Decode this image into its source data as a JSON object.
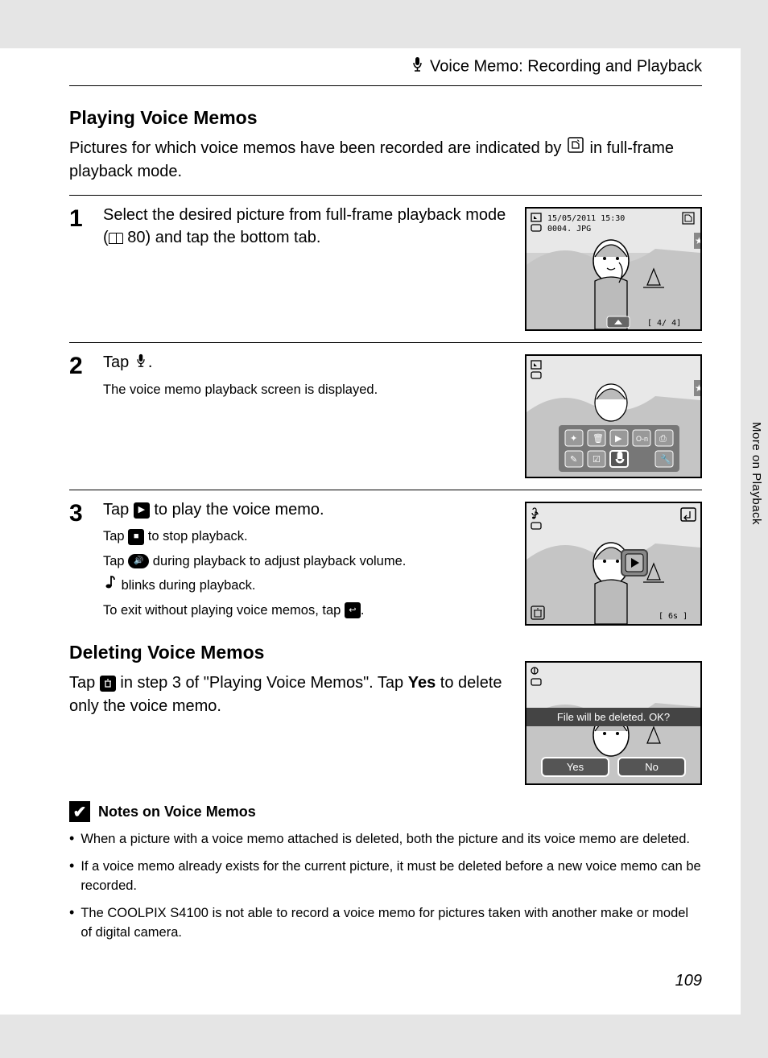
{
  "header": {
    "title": "Voice Memo: Recording and Playback"
  },
  "section_playing": {
    "heading": "Playing Voice Memos",
    "intro_before": "Pictures for which voice memos have been recorded are indicated by ",
    "intro_after": " in full-frame playback mode."
  },
  "steps": [
    {
      "num": "1",
      "title_a": "Select the desired picture from full-frame playback mode (",
      "title_ref": "80",
      "title_b": ") and tap the bottom tab.",
      "screen": {
        "timestamp": "15/05/2011 15:30",
        "filename": "0004. JPG",
        "counter": "4/     4"
      }
    },
    {
      "num": "2",
      "title": "Tap ",
      "title_end": ".",
      "sub": "The voice memo playback screen is displayed."
    },
    {
      "num": "3",
      "title": "Tap ",
      "title_end": " to play the voice memo.",
      "subs": [
        {
          "a": "Tap ",
          "b": " to stop playback."
        },
        {
          "a": "Tap ",
          "b": " during playback to adjust playback volume."
        },
        {
          "a": "",
          "b": " blinks during playback."
        },
        {
          "a": "To exit without playing voice memos, tap ",
          "b": "."
        }
      ],
      "screen": {
        "duration": "6s"
      }
    }
  ],
  "section_deleting": {
    "heading": "Deleting Voice Memos",
    "body_a": "Tap ",
    "body_b": " in step 3 of \"Playing Voice Memos\". Tap ",
    "body_bold": "Yes",
    "body_c": " to delete only the voice memo.",
    "dialog": {
      "prompt": "File will be deleted. OK?",
      "yes": "Yes",
      "no": "No"
    }
  },
  "notes": {
    "heading": "Notes on Voice Memos",
    "items": [
      "When a picture with a voice memo attached is deleted, both the picture and its voice memo are deleted.",
      "If a voice memo already exists for the current picture, it must be deleted before a new voice memo can be recorded.",
      "The COOLPIX S4100 is not able to record a voice memo for pictures taken with another make or model of digital camera."
    ]
  },
  "side_label": "More on Playback",
  "page_number": "109"
}
